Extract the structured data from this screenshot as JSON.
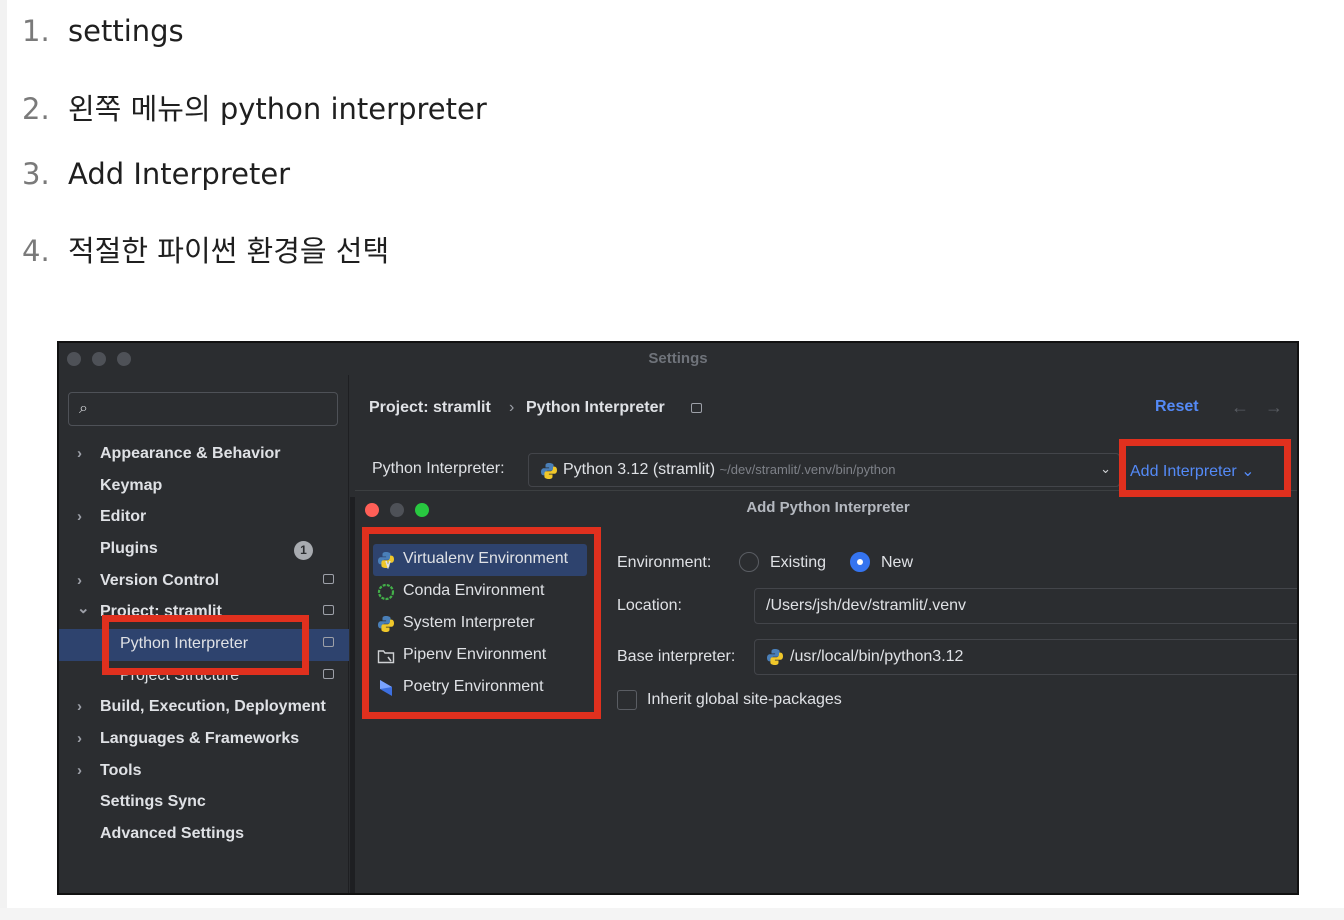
{
  "steps": [
    {
      "num": "1.",
      "text": "settings"
    },
    {
      "num": "2.",
      "text": "왼쪽 메뉴의 python interpreter"
    },
    {
      "num": "3.",
      "text": "Add Interpreter"
    },
    {
      "num": "4.",
      "text": "적절한 파이썬 환경을 선택"
    }
  ],
  "window": {
    "title": "Settings"
  },
  "sidebar": {
    "search_placeholder": "",
    "items": [
      {
        "label": "Appearance & Behavior",
        "chevron": "›"
      },
      {
        "label": "Keymap"
      },
      {
        "label": "Editor",
        "chevron": "›"
      },
      {
        "label": "Plugins",
        "badge": "1"
      },
      {
        "label": "Version Control",
        "chevron": "›"
      },
      {
        "label": "Project: stramlit",
        "chevron": "⌄"
      },
      {
        "label": "Python Interpreter"
      },
      {
        "label": "Project Structure"
      },
      {
        "label": "Build, Execution, Deployment",
        "chevron": "›"
      },
      {
        "label": "Languages & Frameworks",
        "chevron": "›"
      },
      {
        "label": "Tools",
        "chevron": "›"
      },
      {
        "label": "Settings Sync"
      },
      {
        "label": "Advanced Settings"
      }
    ]
  },
  "header": {
    "breadcrumb_project": "Project: stramlit",
    "breadcrumb_sep": "›",
    "breadcrumb_page": "Python Interpreter",
    "reset": "Reset",
    "back": "←",
    "forward": "→"
  },
  "interpreter": {
    "label": "Python Interpreter:",
    "value": "Python 3.12 (stramlit)",
    "path": "~/dev/stramlit/.venv/bin/python",
    "caret": "⌄",
    "add_button": "Add Interpreter ⌄"
  },
  "dialog": {
    "title": "Add Python Interpreter",
    "env_types": [
      {
        "label": "Virtualenv Environment",
        "icon": "virtualenv-icon"
      },
      {
        "label": "Conda Environment",
        "icon": "conda-icon"
      },
      {
        "label": "System Interpreter",
        "icon": "python-icon"
      },
      {
        "label": "Pipenv Environment",
        "icon": "pipenv-icon"
      },
      {
        "label": "Poetry Environment",
        "icon": "poetry-icon"
      }
    ],
    "environment_label": "Environment:",
    "option_existing": "Existing",
    "option_new": "New",
    "location_label": "Location:",
    "location_value": "/Users/jsh/dev/stramlit/.venv",
    "base_label": "Base interpreter:",
    "base_value": "/usr/local/bin/python3.12",
    "inherit_label": "Inherit global site-packages"
  },
  "colors": {
    "accent": "#548af7",
    "highlight": "#e0301e",
    "selection": "#2e436e"
  }
}
